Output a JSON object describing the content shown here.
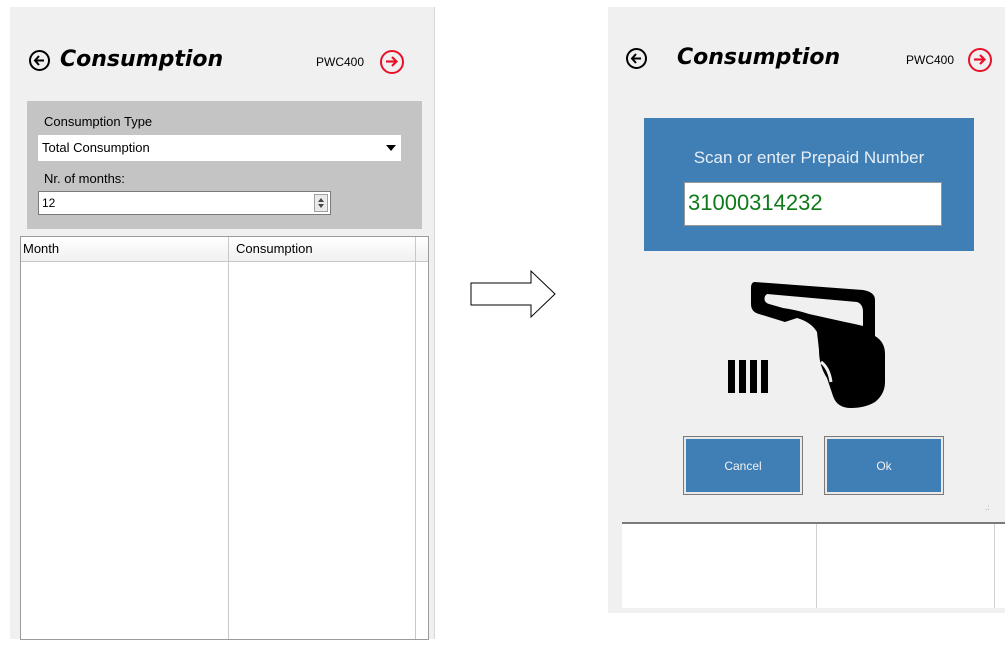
{
  "left_screen": {
    "title": "Consumption",
    "device_code": "PWC400",
    "filters": {
      "consumption_type_label": "Consumption Type",
      "consumption_type_value": "Total Consumption",
      "months_label": "Nr. of months:",
      "months_value": "12"
    },
    "grid": {
      "columns": [
        "Month",
        "Consumption"
      ]
    }
  },
  "right_screen": {
    "title": "Consumption",
    "device_code": "PWC400",
    "dialog": {
      "prompt": "Scan or enter Prepaid Number",
      "prepaid_number": "31000314232",
      "cancel_label": "Cancel",
      "ok_label": "Ok"
    }
  },
  "icons": {
    "back": "back-arrow-circle-icon",
    "next": "next-arrow-circle-icon",
    "scanner": "barcode-scanner-icon",
    "transition": "right-arrow-icon"
  },
  "colors": {
    "accent_blue": "#3f7fb6",
    "next_red": "#e8102a",
    "input_text_green": "#0f7a1a",
    "panel_gray": "#f0f0f0"
  }
}
